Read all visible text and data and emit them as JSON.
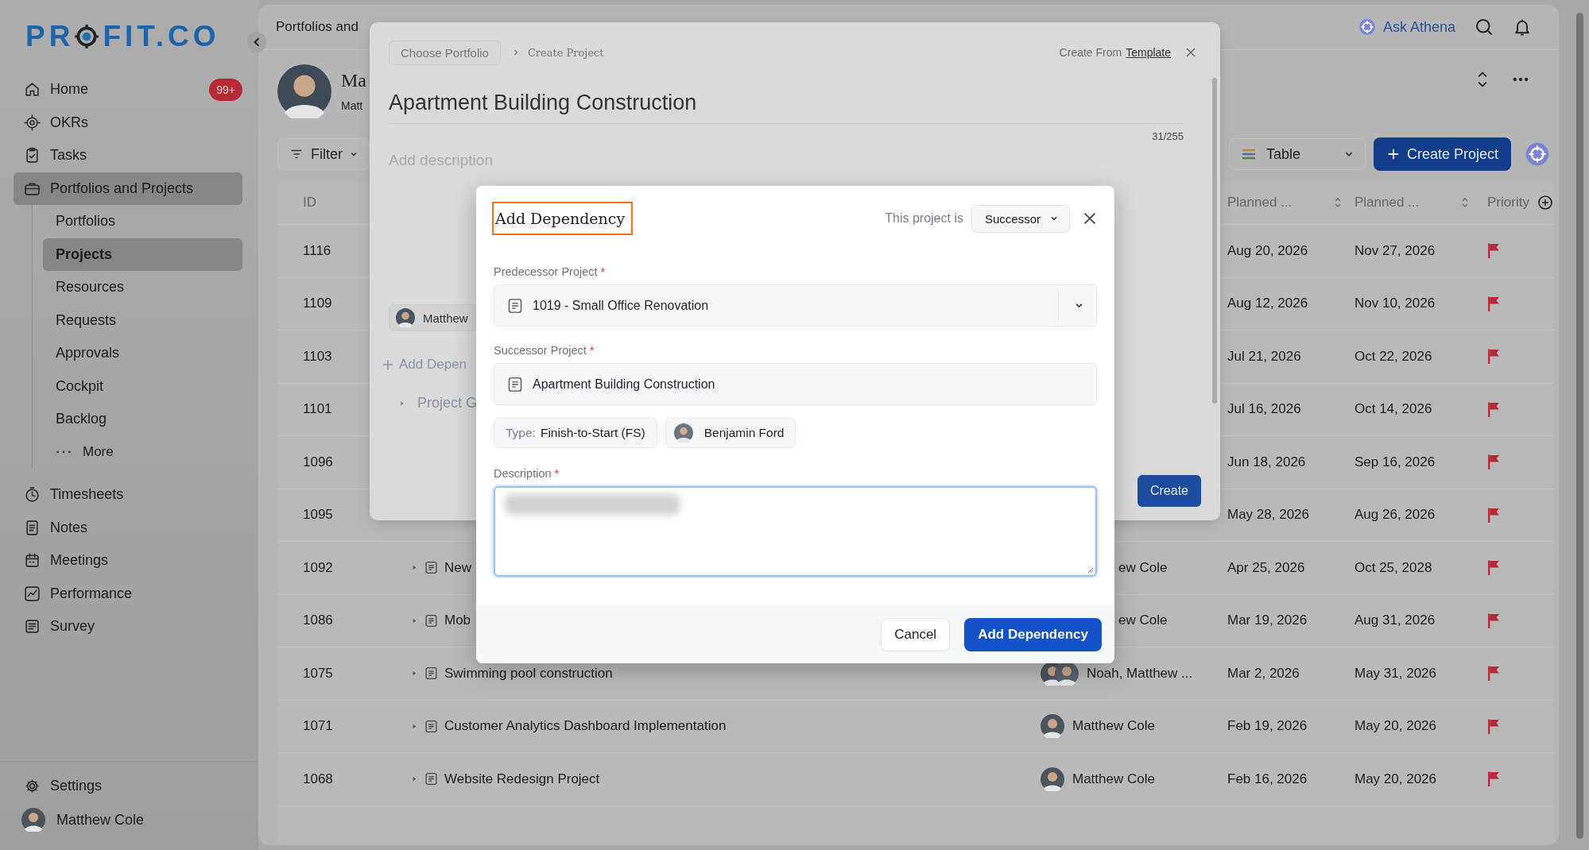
{
  "sidebar": {
    "logo": {
      "left": "PR",
      "right": "FIT.CO"
    },
    "items": [
      {
        "label": "Home",
        "selected": false,
        "badge": "99+"
      },
      {
        "label": "OKRs",
        "selected": false
      },
      {
        "label": "Tasks",
        "selected": false
      },
      {
        "label": "Portfolios and Projects",
        "selected": true,
        "children": [
          {
            "kind": "link",
            "label": "Portfolios",
            "selected": false
          },
          {
            "kind": "link",
            "label": "Projects",
            "selected": true
          },
          {
            "kind": "link",
            "label": "Resources",
            "selected": false
          },
          {
            "kind": "link",
            "label": "Requests",
            "selected": false
          },
          {
            "kind": "link",
            "label": "Approvals",
            "selected": false
          },
          {
            "kind": "link",
            "label": "Cockpit",
            "selected": false
          },
          {
            "kind": "link",
            "label": "Backlog",
            "selected": false
          },
          {
            "kind": "more",
            "label": "More",
            "selected": false
          }
        ]
      },
      {
        "label": "Timesheets",
        "selected": false
      },
      {
        "label": "Notes",
        "selected": false
      },
      {
        "label": "Meetings",
        "selected": false
      },
      {
        "label": "Performance",
        "selected": false
      },
      {
        "label": "Survey",
        "selected": false
      }
    ],
    "settings": "Settings",
    "user": "Matthew Cole"
  },
  "topbar": {
    "breadcrumb": "Portfolios and",
    "assistant": "Ask Athena"
  },
  "profile": {
    "title": "Ma",
    "subtitle": "Matt"
  },
  "toolbar": {
    "filter": "Filter",
    "view": "Table",
    "create": "Create Project"
  },
  "table": {
    "header": {
      "id": "ID",
      "start": "Planned ...",
      "end": "Planned ...",
      "priority": "Priority"
    },
    "rows": [
      {
        "id": "1116",
        "start": "Aug 20, 2026",
        "end": "Nov 27, 2026"
      },
      {
        "id": "1109",
        "start": "Aug 12, 2026",
        "end": "Nov 10, 2026"
      },
      {
        "id": "1103",
        "start": "Jul 21, 2026",
        "end": "Oct 22, 2026"
      },
      {
        "id": "1101",
        "start": "Jul 16, 2026",
        "end": "Oct 14, 2026"
      },
      {
        "id": "1096",
        "start": "Jun 18, 2026",
        "end": "Sep 16, 2026"
      },
      {
        "id": "1095",
        "start": "May 28, 2026",
        "end": "Aug 26, 2026"
      },
      {
        "id": "1092",
        "name": "New",
        "owner": "ew Cole",
        "kind": "partial",
        "start": "Apr 25, 2026",
        "end": "Oct 25, 2028"
      },
      {
        "id": "1086",
        "name": "Mob",
        "owner": "ew Cole",
        "kind": "partial",
        "start": "Mar 19, 2026",
        "end": "Aug 31, 2026"
      },
      {
        "id": "1075",
        "name": "Swimming pool construction",
        "owner": "Noah, Matthew ...",
        "kind": "group",
        "start": "Mar 2, 2026",
        "end": "May 31, 2026"
      },
      {
        "id": "1071",
        "name": "Customer Analytics Dashboard Implementation",
        "owner": "Matthew Cole",
        "kind": "person",
        "start": "Feb 19, 2026",
        "end": "May 20, 2026"
      },
      {
        "id": "1068",
        "name": "Website Redesign Project",
        "owner": "Matthew Cole",
        "kind": "person",
        "start": "Feb 16, 2026",
        "end": "May 20, 2026"
      }
    ]
  },
  "create_panel": {
    "portfolio": "Choose Portfolio",
    "current": "Create Project",
    "template_prefix": "Create From",
    "template_link": "Template",
    "title": "Apartment Building Construction",
    "counter": "31/255",
    "description": {
      "placeholder": "Add description"
    },
    "owner": "Matthew",
    "add_dependency": "Add Depen",
    "group": "Project G",
    "create": "Create"
  },
  "dialog": {
    "title": "Add Dependency",
    "role_label": "This project is",
    "role": "Successor",
    "fields": [
      {
        "kind": "select",
        "label": "Predecessor Project",
        "mark": "*",
        "value": "1019 - Small Office Renovation"
      },
      {
        "kind": "readonly",
        "label": "Successor Project",
        "mark": "*",
        "value": "Apartment Building Construction"
      }
    ],
    "type_label": "Type:",
    "type_value": "Finish-to-Start (FS)",
    "assignee": "Benjamin Ford",
    "description": {
      "label": "Description",
      "mark": "*"
    },
    "cancel": "Cancel",
    "submit": "Add Dependency"
  }
}
